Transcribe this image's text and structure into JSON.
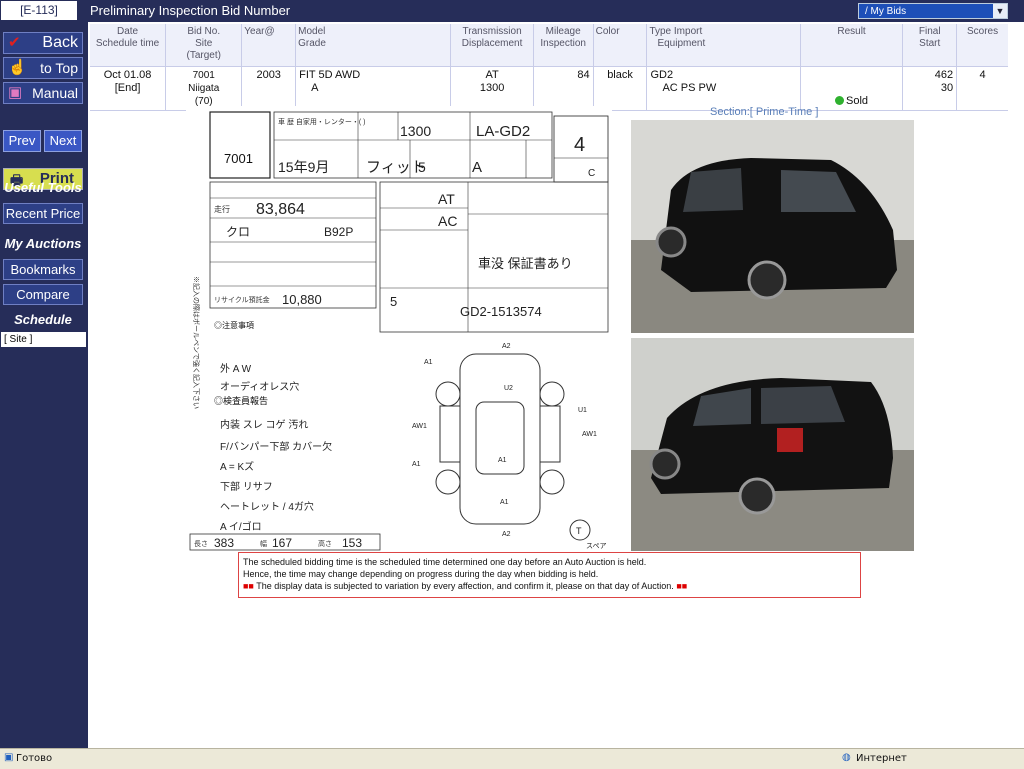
{
  "header": {
    "site_id": "[E-113]",
    "title": "Preliminary Inspection Bid Number",
    "dropdown_value": "/ My Bids"
  },
  "sidebar": {
    "back": "Back",
    "to_top": "to Top",
    "manual": "Manual",
    "prev": "Prev",
    "next": "Next",
    "print": "Print",
    "useful_tools": "Useful Tools",
    "recent_price": "Recent Price",
    "my_auctions": "My Auctions",
    "bookmarks": "Bookmarks",
    "compare": "Compare",
    "schedule": "Schedule",
    "site_field": "[ Site ]"
  },
  "table": {
    "headers": {
      "date": [
        "Date",
        "Schedule time"
      ],
      "bid": [
        "Bid No.",
        "Site",
        "(Target)"
      ],
      "year": [
        "Year@"
      ],
      "model": [
        "Model",
        "Grade"
      ],
      "trans": [
        "Transmission",
        "Displacement"
      ],
      "mileage": [
        "Mileage",
        "Inspection"
      ],
      "color": [
        "Color"
      ],
      "type": [
        "Type  Import",
        "Equipment"
      ],
      "result": [
        "Result"
      ],
      "final": [
        "Final",
        "Start"
      ],
      "scores": [
        "Scores"
      ]
    },
    "row": {
      "date": "Oct 01.08",
      "time": "[End]",
      "bid_no": "7001",
      "site": "Niigata",
      "target": "(70)",
      "year": "2003",
      "model": "FIT 5D AWD",
      "grade": "A",
      "transmission": "AT",
      "displacement": "1300",
      "mileage": "84",
      "color": "black",
      "type": "GD2",
      "equipment": "AC PS PW",
      "result": "Sold",
      "final": "462",
      "start": "30",
      "score": "4"
    }
  },
  "section_label": "Section:[ Prime-Time ]",
  "sheet": {
    "lot": "7001",
    "code": "LA-GD2",
    "displacement": "1300",
    "score": "4",
    "score_sub": "C",
    "year": "15年9月",
    "model": "フィット",
    "doors": "5",
    "grade": "A",
    "trans": "AT",
    "ac": "AC",
    "mileage": "83,864",
    "color_code": "B92P",
    "color": "クロ",
    "seats": "5",
    "chassis": "GD2-1513574",
    "recycle": "10,880",
    "notes_line": "車没 保証書あり",
    "size_l": "383",
    "size_w": "167",
    "size_h": "153",
    "handwritten": [
      "外 A W",
      "オーディオレス穴",
      "内装 スレ コゲ 汚れ",
      "F/バンパー下部 カバー欠",
      "A = Kズ",
      "下部 リサフ",
      "ヘートレット / 4ガ穴",
      "A イ/ゴロ"
    ],
    "label_inspector": "◎検査員報告",
    "label_notes": "◎注意事項",
    "vertical_text": "※記入の際はボールペンで強く記入下さい",
    "panel_marks": [
      "A2",
      "U2",
      "A1",
      "A1",
      "AW1",
      "AW1",
      "A1",
      "A2",
      "A1",
      "U1"
    ],
    "tire_mark": "T",
    "spare_label": "スペア"
  },
  "notice": {
    "line1": "The scheduled bidding time is the scheduled time determined one day before an Auto Auction is held.",
    "line2": "Hence, the time may change depending on progress during the day when bidding is held.",
    "line3": "The display data is subjected to variation by every affection, and confirm it, please on that day of Auction."
  },
  "statusbar": {
    "status": "Готово",
    "zone": "Интернет"
  }
}
